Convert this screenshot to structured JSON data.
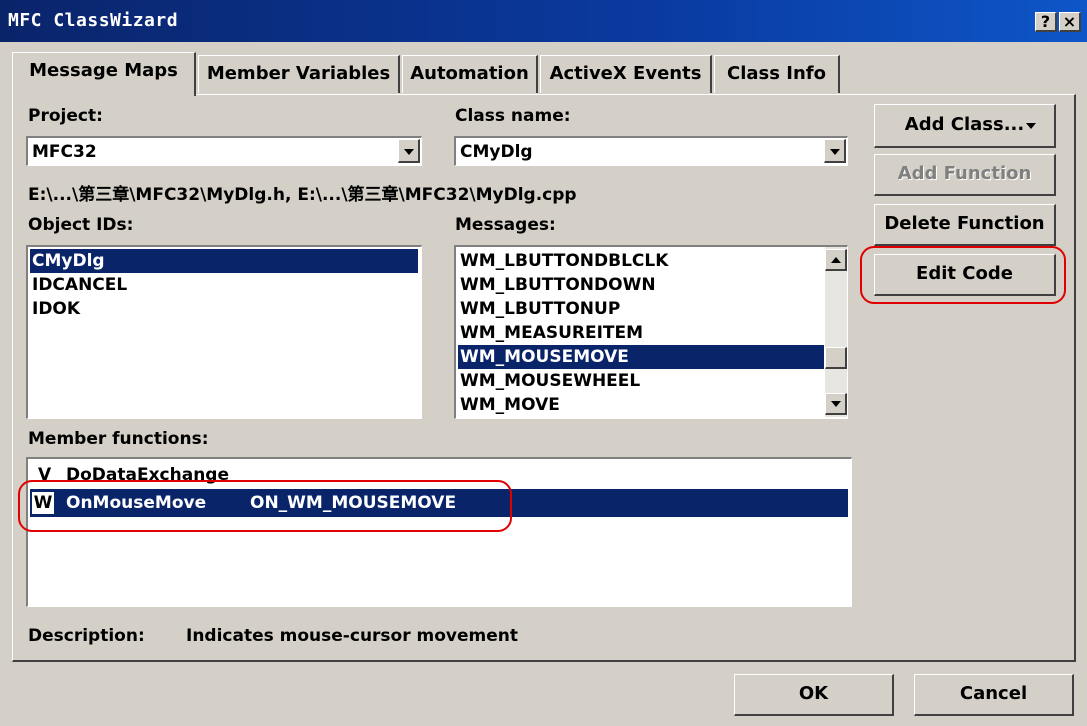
{
  "window": {
    "title": "MFC ClassWizard",
    "help_glyph": "?",
    "close_glyph": "×"
  },
  "tabs": [
    {
      "label": "Message Maps",
      "active": true
    },
    {
      "label": "Member Variables"
    },
    {
      "label": "Automation"
    },
    {
      "label": "ActiveX Events"
    },
    {
      "label": "Class Info"
    }
  ],
  "project": {
    "label": "Project:",
    "value": "MFC32"
  },
  "class_name": {
    "label": "Class name:",
    "value": "CMyDlg"
  },
  "path_text": "E:\\...\\第三章\\MFC32\\MyDlg.h, E:\\...\\第三章\\MFC32\\MyDlg.cpp",
  "object_ids": {
    "label": "Object IDs:",
    "items": [
      "CMyDlg",
      "IDCANCEL",
      "IDOK"
    ],
    "selected_index": 0
  },
  "messages": {
    "label": "Messages:",
    "items": [
      "WM_LBUTTONDBLCLK",
      "WM_LBUTTONDOWN",
      "WM_LBUTTONUP",
      "WM_MEASUREITEM",
      "WM_MOUSEMOVE",
      "WM_MOUSEWHEEL",
      "WM_MOVE"
    ],
    "selected_index": 4
  },
  "member_functions": {
    "label": "Member functions:",
    "items": [
      {
        "prefix": "V",
        "name": "DoDataExchange",
        "handler": ""
      },
      {
        "prefix": "W",
        "name": "OnMouseMove",
        "handler": "ON_WM_MOUSEMOVE"
      }
    ],
    "selected_index": 1
  },
  "description": {
    "label": "Description:",
    "text": "Indicates mouse-cursor movement"
  },
  "buttons": {
    "add_class": "Add Class...",
    "add_function": "Add Function",
    "delete_function": "Delete Function",
    "edit_code": "Edit Code",
    "ok": "OK",
    "cancel": "Cancel"
  },
  "colors": {
    "selection": "#0a246a",
    "highlight_annotation": "#e00000",
    "face": "#d4d0c8"
  }
}
